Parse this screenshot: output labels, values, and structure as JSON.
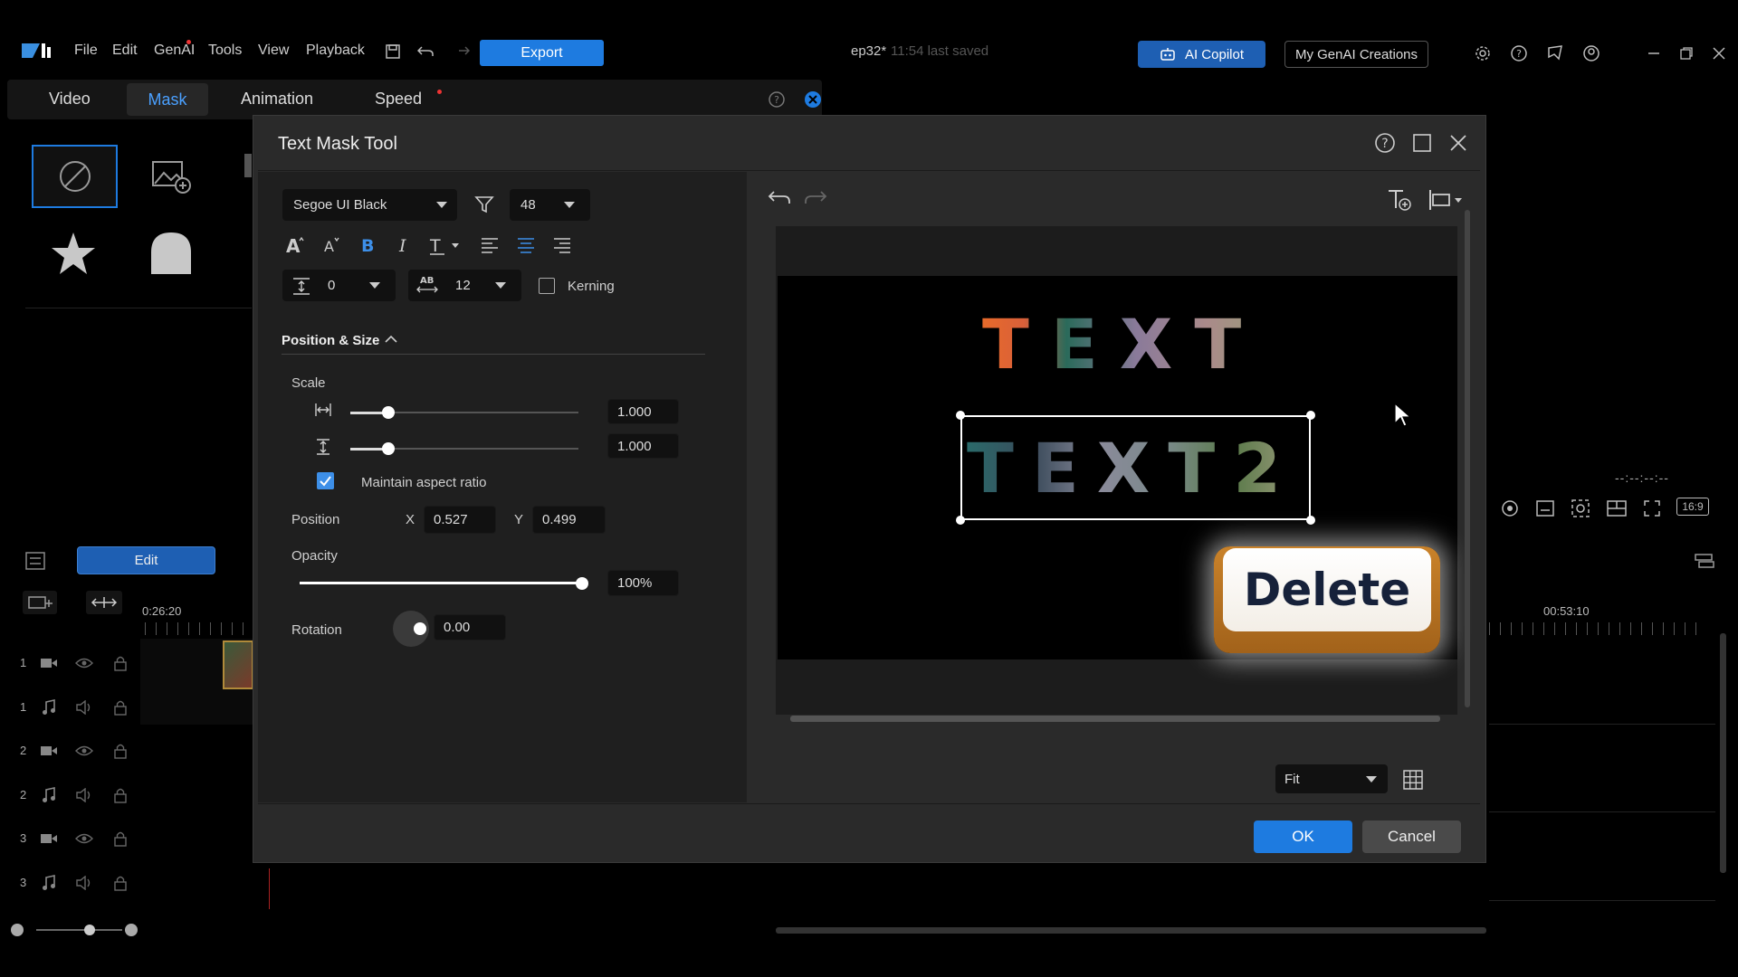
{
  "menubar": {
    "file": "File",
    "edit": "Edit",
    "genai": "GenAI",
    "tools": "Tools",
    "view": "View",
    "playback": "Playback",
    "export_label": "Export",
    "project_name": "ep32*",
    "saved_status": "11:54 last saved",
    "ai_copilot": "AI Copilot",
    "my_genai": "My GenAI Creations"
  },
  "tabs": {
    "video": "Video",
    "mask": "Mask",
    "animation": "Animation",
    "speed": "Speed"
  },
  "left_panel": {
    "edit_button": "Edit",
    "timecode_left": "0:26:20",
    "tracks": [
      "1",
      "1",
      "2",
      "2",
      "3",
      "3"
    ]
  },
  "right_bg": {
    "timecode_right": "00:53:10",
    "aspect_label": "16:9",
    "timecode_dashes": "--:--:--:--"
  },
  "dialog": {
    "title": "Text Mask Tool",
    "font_family": "Segoe UI Black",
    "font_size": "48",
    "line_spacing": "0",
    "char_spacing": "12",
    "kerning_label": "Kerning",
    "section_title": "Position & Size",
    "scale_label": "Scale",
    "scale_width": "1.000",
    "scale_height": "1.000",
    "maintain_aspect": "Maintain aspect ratio",
    "position_label": "Position",
    "x_label": "X",
    "x_value": "0.527",
    "y_label": "Y",
    "y_value": "0.499",
    "opacity_label": "Opacity",
    "opacity_value": "100%",
    "opacity_level": 1.0,
    "rotation_label": "Rotation",
    "rotation_value": "0.00",
    "preview_text1": "TEXT",
    "preview_text2": "TEXT2",
    "delete_label": "Delete",
    "zoom_value": "Fit",
    "ok_label": "OK",
    "cancel_label": "Cancel"
  },
  "colors": {
    "accent_blue": "#1e7be0",
    "dialog_bg": "#2a2a2a",
    "panel_bg": "#1f1f1f"
  }
}
